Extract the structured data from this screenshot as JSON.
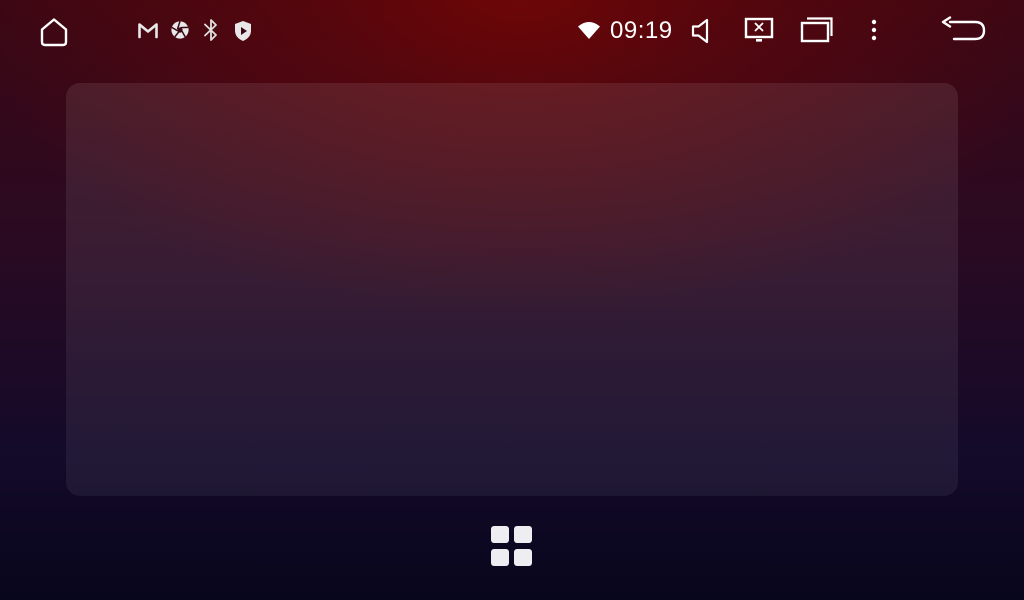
{
  "status_bar": {
    "clock": "09:19",
    "left_icons": [
      "home-icon"
    ],
    "notification_icons": [
      "gmail-icon",
      "camera-aperture-icon",
      "bluetooth-icon",
      "shield-play-icon"
    ],
    "system_icons": [
      "wifi-icon",
      "volume-icon",
      "screen-off-icon",
      "recent-apps-icon",
      "more-options-icon",
      "back-icon"
    ]
  },
  "main": {
    "widget_panel": "empty",
    "app_drawer_icon": "app-drawer-grid-icon"
  },
  "colors": {
    "background_top": "#6e0606",
    "background_bottom": "#08061c",
    "icon": "#ffffff"
  }
}
